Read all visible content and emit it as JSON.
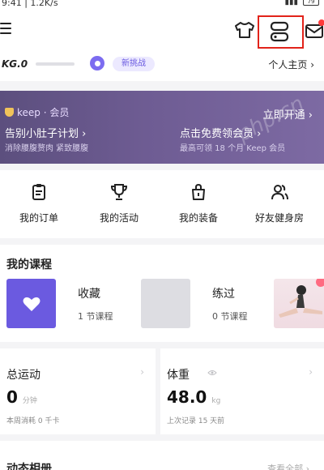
{
  "status": {
    "time_speed": "9:41 | 1.2K/s",
    "battery": "79"
  },
  "header": {
    "kg_label": "KG.0",
    "challenge_chip": "新挑战",
    "profile_link": "个人主页 ›"
  },
  "banner": {
    "brand": "keep · 会员",
    "cta": "立即开通 ›",
    "left_title": "告别小肚子计划 ›",
    "left_sub": "消除腰腹赘肉 紧致腰腹",
    "right_title": "点击免费领会员 ›",
    "right_sub": "最高可领 18 个月 Keep 会员",
    "watermark": "php.cn"
  },
  "actions": [
    {
      "label": "我的订单",
      "icon": "order-icon"
    },
    {
      "label": "我的活动",
      "icon": "trophy-icon"
    },
    {
      "label": "我的装备",
      "icon": "bag-icon"
    },
    {
      "label": "好友健身房",
      "icon": "friends-icon"
    }
  ],
  "courses": {
    "title": "我的课程",
    "favorites": {
      "name": "收藏",
      "count": "1 节课程"
    },
    "done": {
      "name": "练过",
      "count": "0 节课程"
    }
  },
  "stats": {
    "total": {
      "title": "总运动",
      "value": "0",
      "unit": "分钟",
      "sub": "本周消耗 0 千卡",
      "chevron": "›"
    },
    "weight": {
      "title": "体重",
      "value": "48.0",
      "unit": "kg",
      "sub": "上次记录 15 天前",
      "chevron": "›"
    }
  },
  "bottom": {
    "title": "动态相册",
    "right": "查看全部 ›"
  },
  "colors": {
    "accent": "#6b5ae0",
    "highlight": "#e2231a",
    "banner": "#6e5c93"
  }
}
